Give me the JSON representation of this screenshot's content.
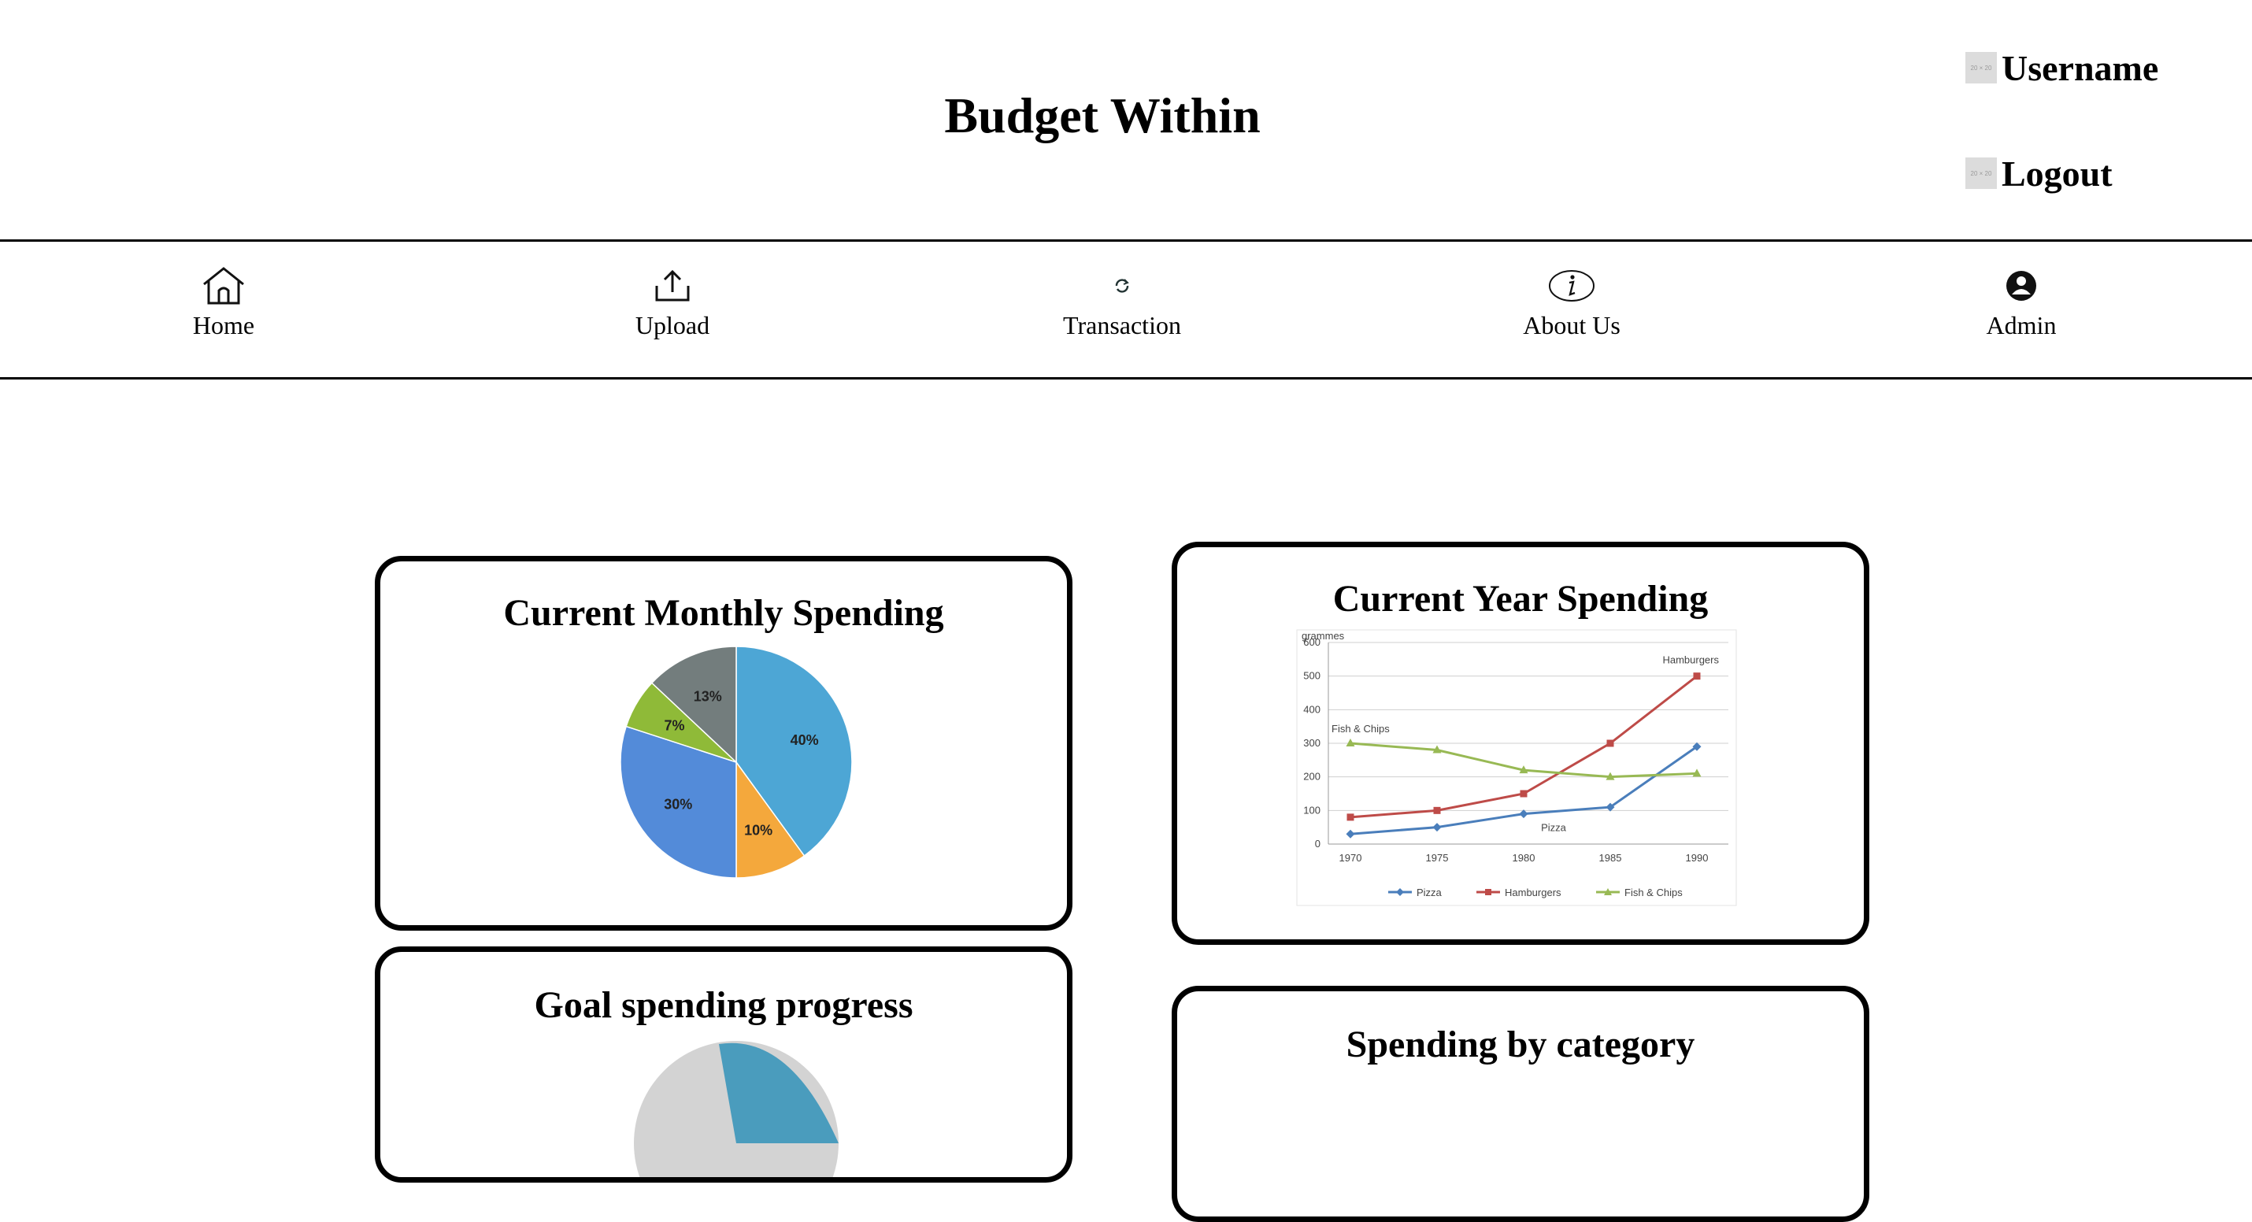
{
  "header": {
    "title": "Budget Within",
    "user_label": "Username",
    "logout_label": "Logout",
    "thumb_text": "20 × 20"
  },
  "nav": {
    "items": [
      {
        "label": "Home",
        "icon": "home-icon"
      },
      {
        "label": "Upload",
        "icon": "upload-icon"
      },
      {
        "label": "Transaction",
        "icon": "refresh-icon"
      },
      {
        "label": "About Us",
        "icon": "info-icon"
      },
      {
        "label": "Admin",
        "icon": "user-circle-icon"
      }
    ]
  },
  "cards": {
    "monthly": {
      "title": "Current Monthly Spending"
    },
    "year": {
      "title": "Current Year Spending"
    },
    "goal": {
      "title": "Goal spending progress"
    },
    "category": {
      "title": "Spending by category"
    }
  },
  "chart_data": [
    {
      "type": "pie",
      "slices": [
        {
          "label": "40%",
          "value": 40,
          "color": "#4da6d5"
        },
        {
          "label": "10%",
          "value": 10,
          "color": "#f4a83c"
        },
        {
          "label": "30%",
          "value": 30,
          "color": "#538bd9"
        },
        {
          "label": "7%",
          "value": 7,
          "color": "#8fba38"
        },
        {
          "label": "13%",
          "value": 13,
          "color": "#737d7d"
        }
      ]
    },
    {
      "type": "line",
      "ylabel": "grammes",
      "x": [
        "1970",
        "1975",
        "1980",
        "1985",
        "1990"
      ],
      "ylim": [
        0,
        600
      ],
      "yticks": [
        "0",
        "100",
        "200",
        "300",
        "400",
        "500",
        "600"
      ],
      "grid": true,
      "legend_position": "bottom",
      "series": [
        {
          "name": "Pizza",
          "values": [
            30,
            50,
            90,
            110,
            290
          ],
          "color": "#4a7ebb"
        },
        {
          "name": "Hamburgers",
          "values": [
            80,
            100,
            150,
            300,
            500
          ],
          "color": "#be4b48"
        },
        {
          "name": "Fish & Chips",
          "values": [
            300,
            280,
            220,
            200,
            210
          ],
          "color": "#98b954"
        }
      ],
      "annotations": [
        "Fish & Chips",
        "Hamburgers",
        "Pizza"
      ]
    },
    {
      "type": "pie",
      "colors": [
        "#d3d3d3",
        "#4a9cbd"
      ]
    }
  ]
}
